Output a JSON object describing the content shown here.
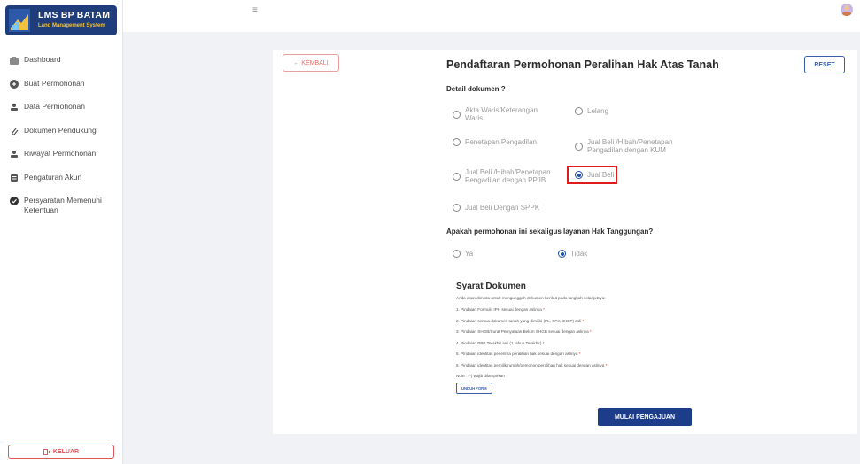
{
  "brand": {
    "title": "LMS BP BATAM",
    "subtitle": "Land Management System"
  },
  "sidebar": {
    "items": [
      {
        "label": "Dashboard",
        "icon": "dashboard-icon"
      },
      {
        "label": "Buat Permohonan",
        "icon": "create-request-icon"
      },
      {
        "label": "Data Permohonan",
        "icon": "data-icon"
      },
      {
        "label": "Dokumen Pendukung",
        "icon": "attachment-icon"
      },
      {
        "label": "Riwayat Permohonan",
        "icon": "history-icon"
      },
      {
        "label": "Pengaturan Akun",
        "icon": "settings-icon"
      },
      {
        "label": "Persyaratan Memenuhi Ketentuan",
        "icon": "check-circle-icon"
      }
    ],
    "logout_label": "KELUAR"
  },
  "main": {
    "back_label": "← KEMBALI",
    "title": "Pendaftaran Permohonan Peralihan Hak Atas Tanah",
    "reset_label": "RESET",
    "detail_label": "Detail dokumen ?",
    "options": [
      "Akta Waris/Keterangan Waris",
      "Lelang",
      "Penetapan Pengadilan",
      "Jual Beli /Hibah/Penetapan Pengadilan dengan KUM",
      "Jual Beli /Hibah/Penetapan Pengadilan dengan PPJB",
      "Jual Beli",
      "Jual Beli Dengan SPPK"
    ],
    "selected_option": "Jual Beli",
    "hak_question": "Apakah permohonan ini sekaligus layanan Hak Tanggungan?",
    "hak_options": [
      "Ya",
      "Tidak"
    ],
    "hak_selected": "Tidak",
    "syarat": {
      "title": "Syarat Dokumen",
      "intro": "Anda akan diminta untuk mengunggah dokumen berikut pada langkah selanjutnya:",
      "items": [
        "1. Pindaian Formulir IPH sesuai dengan aslinya",
        "2. Pindaian semua dokumen tanah yang dimiliki (PL, SPJ, SKEP) asli",
        "3. Pindaian SHGB/Surat Pernyataan Belum SHGB sesuai dengan aslinya",
        "4. Pindaian PBB Terakhir asli (1 tahun Terakhir)",
        "5. Pindaian identitas penerima peralihan hak sesuai dengan aslinya",
        "6. Pindaian identitas pemilik rumah/pemohon peralihan hak sesuai dengan aslinya"
      ],
      "required_mark": "*",
      "note": "Note : (*) wajib dilampirkan",
      "download_label": "UNDUH FORM"
    },
    "submit_label": "MULAI PENGAJUAN"
  },
  "colors": {
    "brand": "#1f3d7a",
    "accent": "#1d3c8a",
    "danger": "#e01b1b"
  }
}
